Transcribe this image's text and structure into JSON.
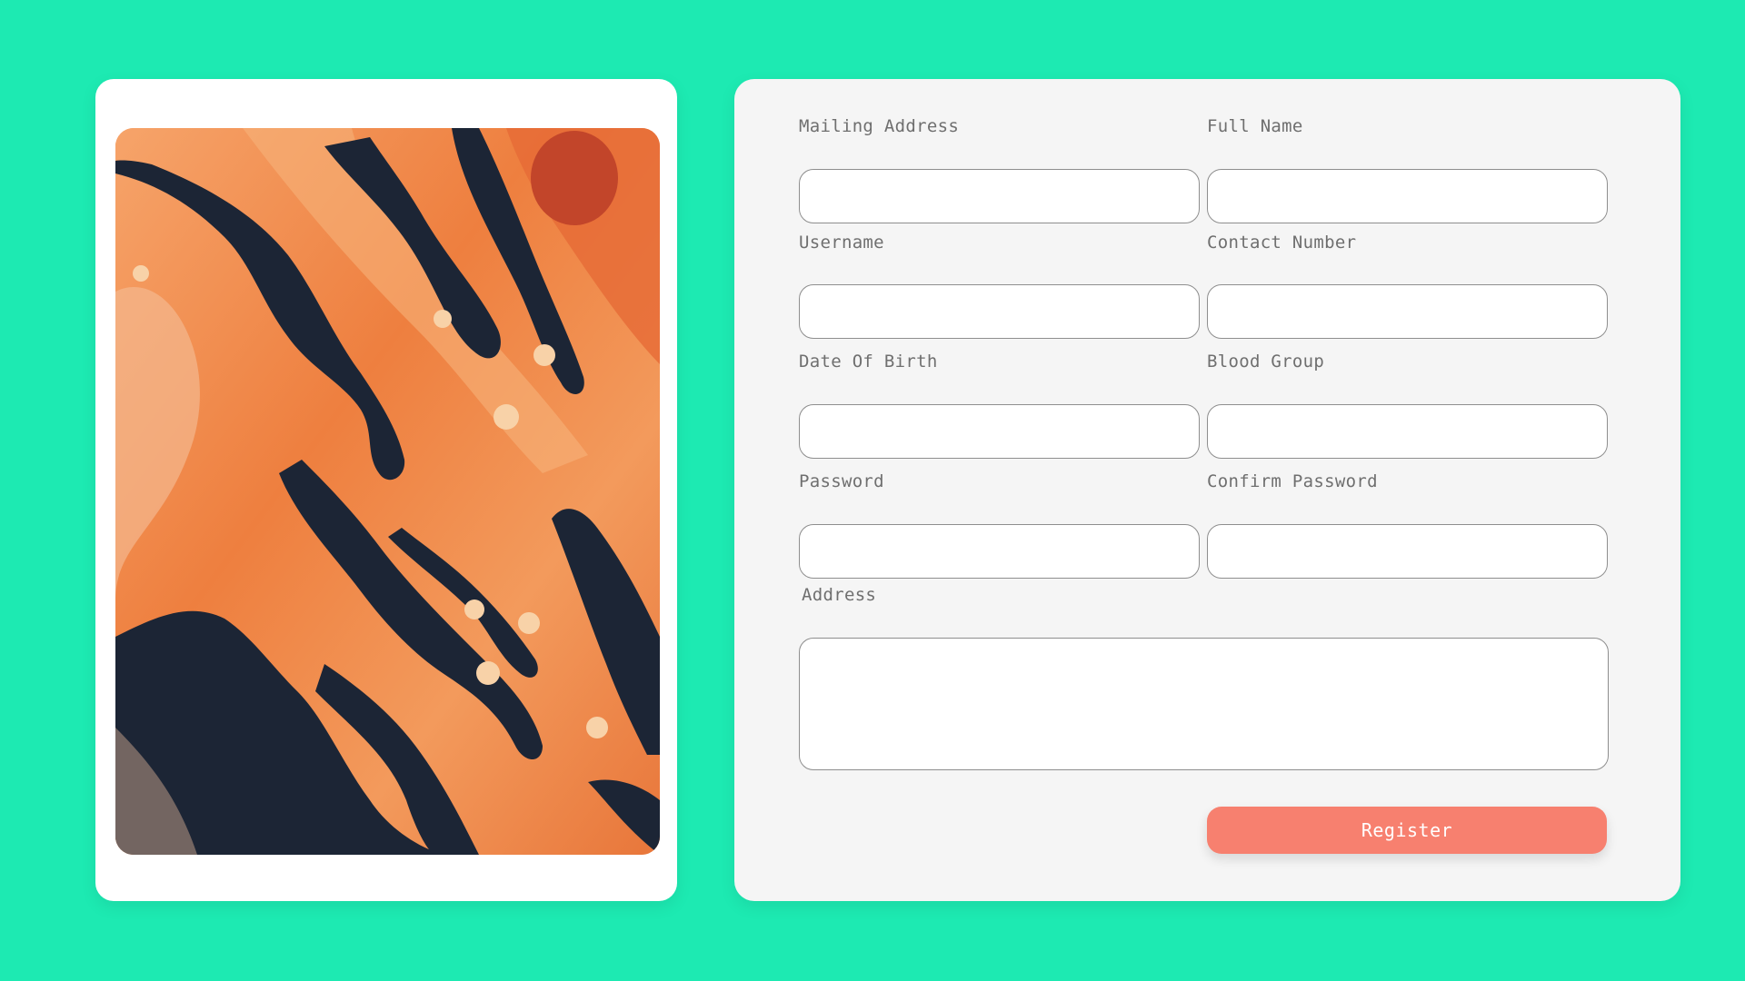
{
  "form": {
    "fields": [
      {
        "label": "Mailing Address",
        "value": ""
      },
      {
        "label": "Full Name",
        "value": ""
      },
      {
        "label": "Username",
        "value": ""
      },
      {
        "label": "Contact Number",
        "value": ""
      },
      {
        "label": "Date Of Birth",
        "value": ""
      },
      {
        "label": "Blood Group",
        "value": ""
      },
      {
        "label": "Password",
        "value": ""
      },
      {
        "label": "Confirm Password",
        "value": ""
      }
    ],
    "address": {
      "label": "Address",
      "value": ""
    },
    "register_label": "Register"
  },
  "colors": {
    "background": "#1deab2",
    "card": "#ffffff",
    "form_card": "#f5f5f5",
    "button": "#f7806f",
    "art_orange": "#f08a4a",
    "art_dark": "#1c2535"
  },
  "image": {
    "description_icon": "abstract-fluid-art-image"
  }
}
